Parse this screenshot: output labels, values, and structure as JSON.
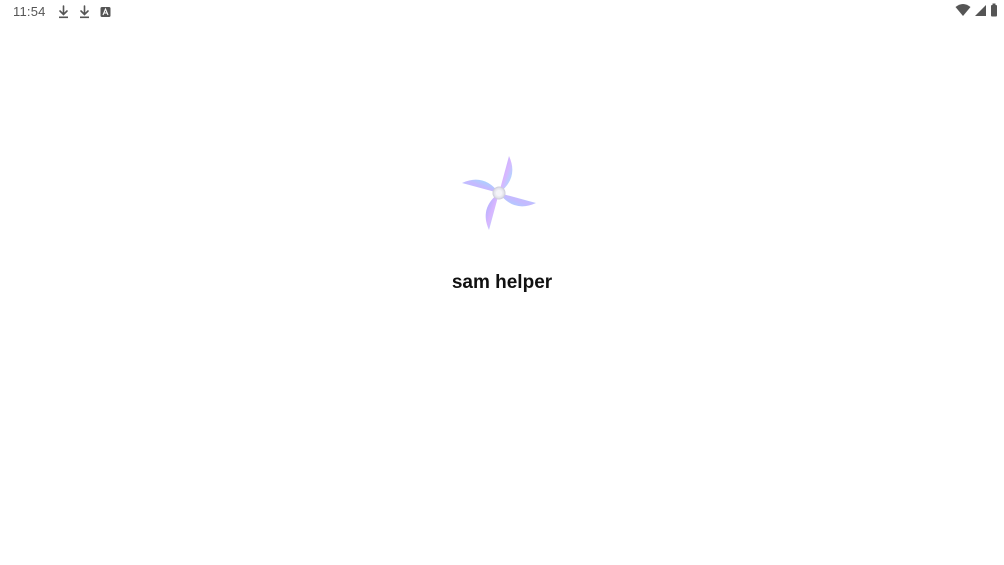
{
  "status_bar": {
    "time": "11:54",
    "notification_icons": [
      "download-icon",
      "download-icon",
      "app-store-icon"
    ],
    "system_icons": [
      "wifi-icon",
      "cell-signal-icon",
      "battery-icon"
    ]
  },
  "splash": {
    "app_name": "sam helper",
    "logo_icon": "pinwheel-logo-icon"
  },
  "colors": {
    "background": "#ffffff",
    "status_icon": "#555555",
    "title": "#111111",
    "logo_gradient": [
      "#a9b8ff",
      "#d8b8ff",
      "#8fe8ff"
    ]
  }
}
